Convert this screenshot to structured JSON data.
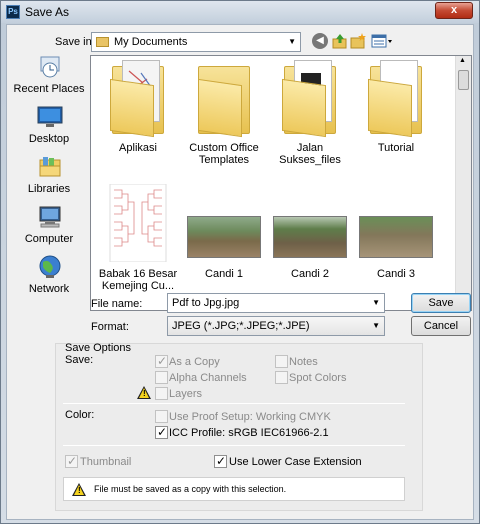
{
  "window": {
    "title": "Save As",
    "app_icon": "Ps",
    "close_label": "x"
  },
  "toolbar": {
    "save_in_label": "Save in:",
    "save_in_value": "My Documents",
    "icons": [
      "back-icon",
      "up-folder-icon",
      "new-folder-icon",
      "views-menu-icon"
    ]
  },
  "places": [
    {
      "label": "Recent Places",
      "icon": "recent-places-icon"
    },
    {
      "label": "Desktop",
      "icon": "desktop-icon"
    },
    {
      "label": "Libraries",
      "icon": "libraries-icon"
    },
    {
      "label": "Computer",
      "icon": "computer-icon"
    },
    {
      "label": "Network",
      "icon": "network-icon"
    }
  ],
  "files": [
    {
      "label": "Aplikasi",
      "kind": "folder"
    },
    {
      "label": "Custom Office Templates",
      "kind": "folder"
    },
    {
      "label": "Jalan Sukses_files",
      "kind": "folder"
    },
    {
      "label": "Tutorial",
      "kind": "folder"
    },
    {
      "label": "Babak 16 Besar Kemejing Cu...",
      "kind": "image"
    },
    {
      "label": "Candi 1",
      "kind": "photo"
    },
    {
      "label": "Candi 2",
      "kind": "photo"
    },
    {
      "label": "Candi 3",
      "kind": "photo"
    }
  ],
  "form": {
    "file_name_label": "File name:",
    "file_name_value": "Pdf to Jpg.jpg",
    "format_label": "Format:",
    "format_value": "JPEG (*.JPG;*.JPEG;*.JPE)",
    "save_button": "Save",
    "cancel_button": "Cancel"
  },
  "options": {
    "heading": "Save Options",
    "save_label": "Save:",
    "as_copy": "As a Copy",
    "alpha_channels": "Alpha Channels",
    "layers": "Layers",
    "notes": "Notes",
    "spot_colors": "Spot Colors",
    "color_label": "Color:",
    "use_proof": "Use Proof Setup:  Working CMYK",
    "icc_profile": "ICC Profile:  sRGB IEC61966-2.1",
    "thumbnail": "Thumbnail",
    "lower_case": "Use Lower Case Extension",
    "warning": "File must be saved as a copy with this selection."
  }
}
